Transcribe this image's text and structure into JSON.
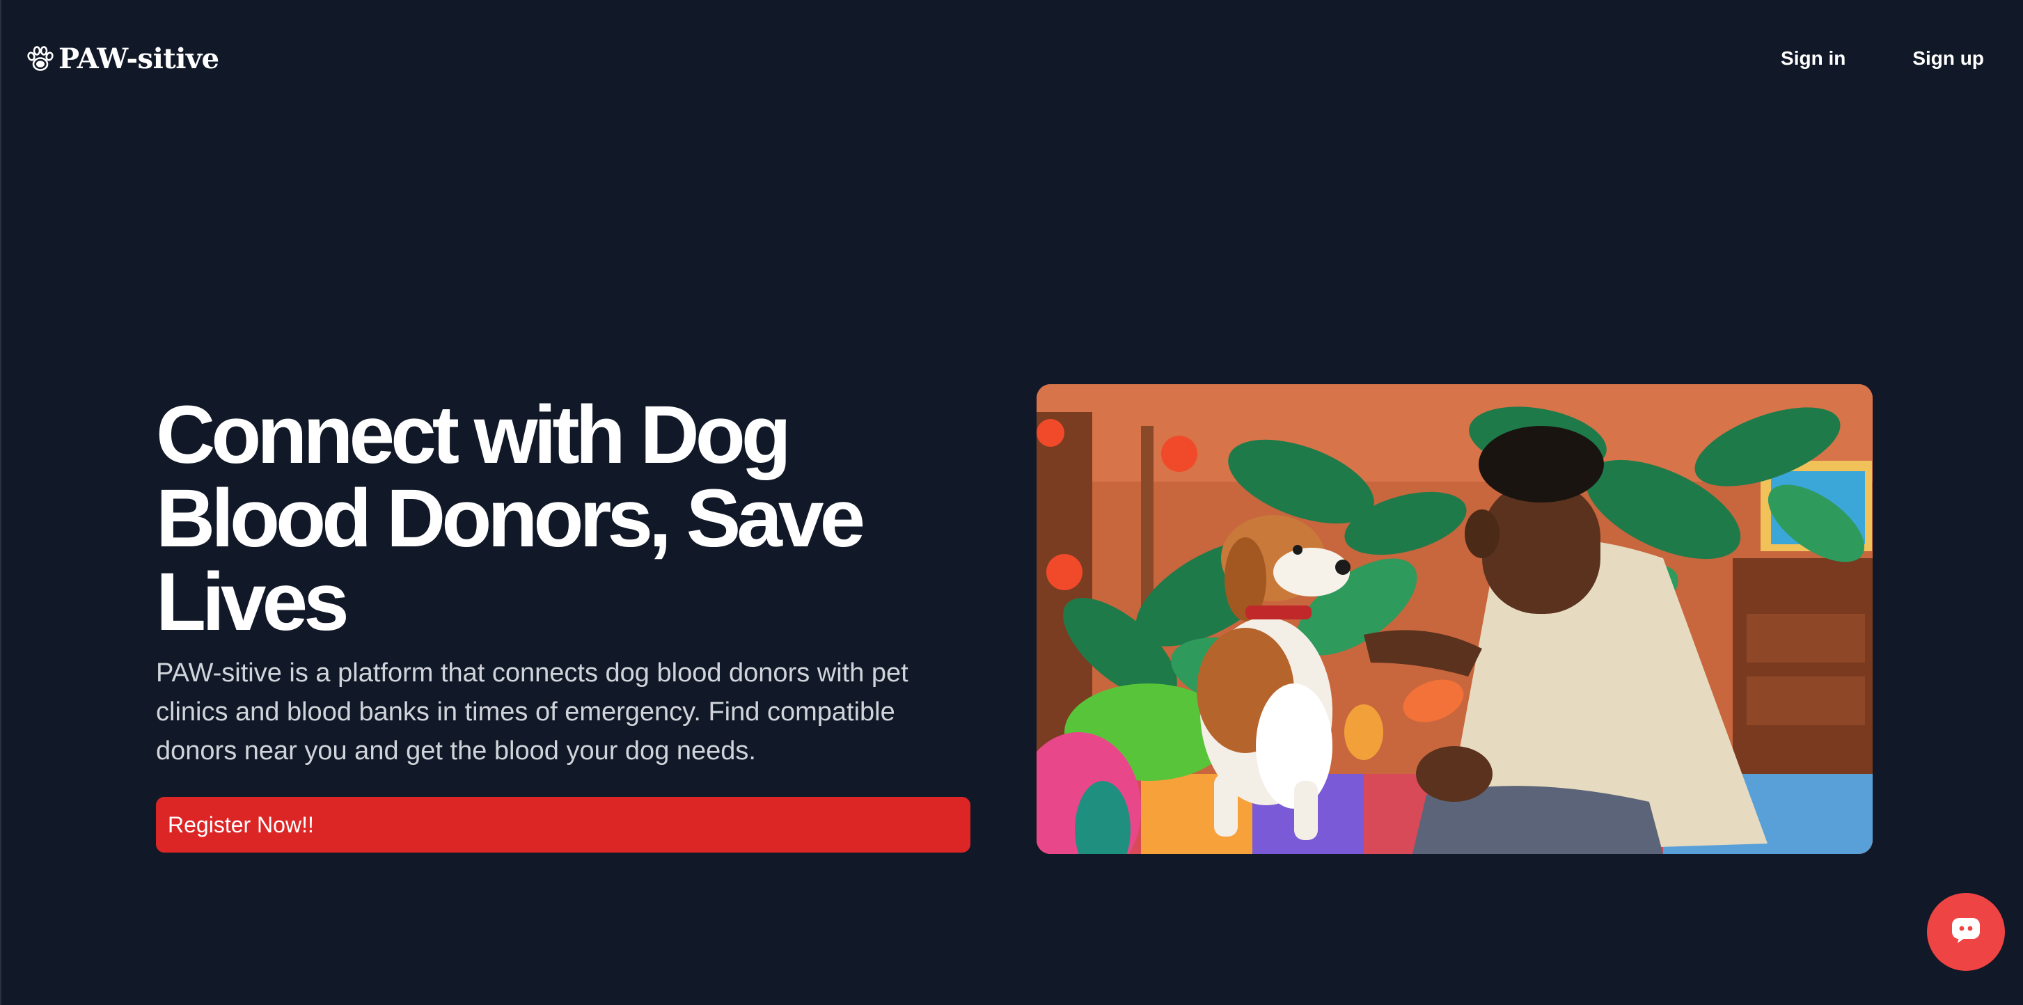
{
  "header": {
    "brand_name": "PAW-sitive",
    "brand_icon": "paw-icon",
    "nav": {
      "sign_in": "Sign in",
      "sign_up": "Sign up"
    }
  },
  "hero": {
    "title": "Connect with Dog Blood Donors, Save Lives",
    "description": "PAW-sitive is a platform that connects dog blood donors with pet clinics and blood banks in times of emergency. Find compatible donors near you and get the blood your dog needs.",
    "cta_label": "Register Now!!",
    "image": "illustration of a man petting a beagle among tropical plants"
  },
  "chat": {
    "icon": "chat-bubble-icon"
  },
  "colors": {
    "background": "#111827",
    "accent": "#dc2626",
    "chat_button": "#ef4444",
    "text_muted": "#d1d5db"
  }
}
